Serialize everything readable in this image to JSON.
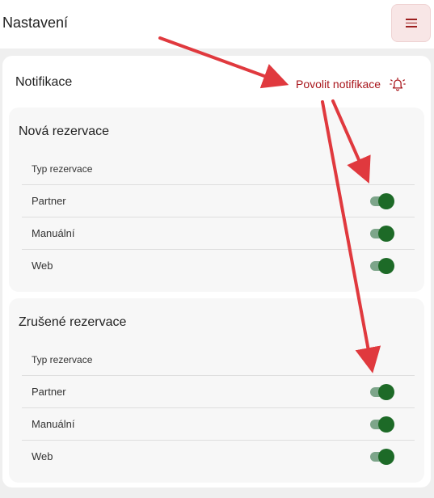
{
  "header": {
    "title": "Nastavení",
    "menu_icon": "hamburger-menu-icon"
  },
  "notifications": {
    "title": "Notifikace",
    "enable_label": "Povolit notifikace",
    "enable_icon": "bell-icon",
    "accent_color": "#a8151b"
  },
  "sections": [
    {
      "title": "Nová rezervace",
      "column_header": "Typ rezervace",
      "rows": [
        {
          "label": "Partner",
          "enabled": true
        },
        {
          "label": "Manuální",
          "enabled": true
        },
        {
          "label": "Web",
          "enabled": true
        }
      ]
    },
    {
      "title": "Zrušené rezervace",
      "column_header": "Typ rezervace",
      "rows": [
        {
          "label": "Partner",
          "enabled": true
        },
        {
          "label": "Manuální",
          "enabled": true
        },
        {
          "label": "Web",
          "enabled": true
        }
      ]
    }
  ],
  "toggle_colors": {
    "track": "#7da58a",
    "thumb": "#1d6a27"
  },
  "annotation_arrow_color": "#e0393e"
}
